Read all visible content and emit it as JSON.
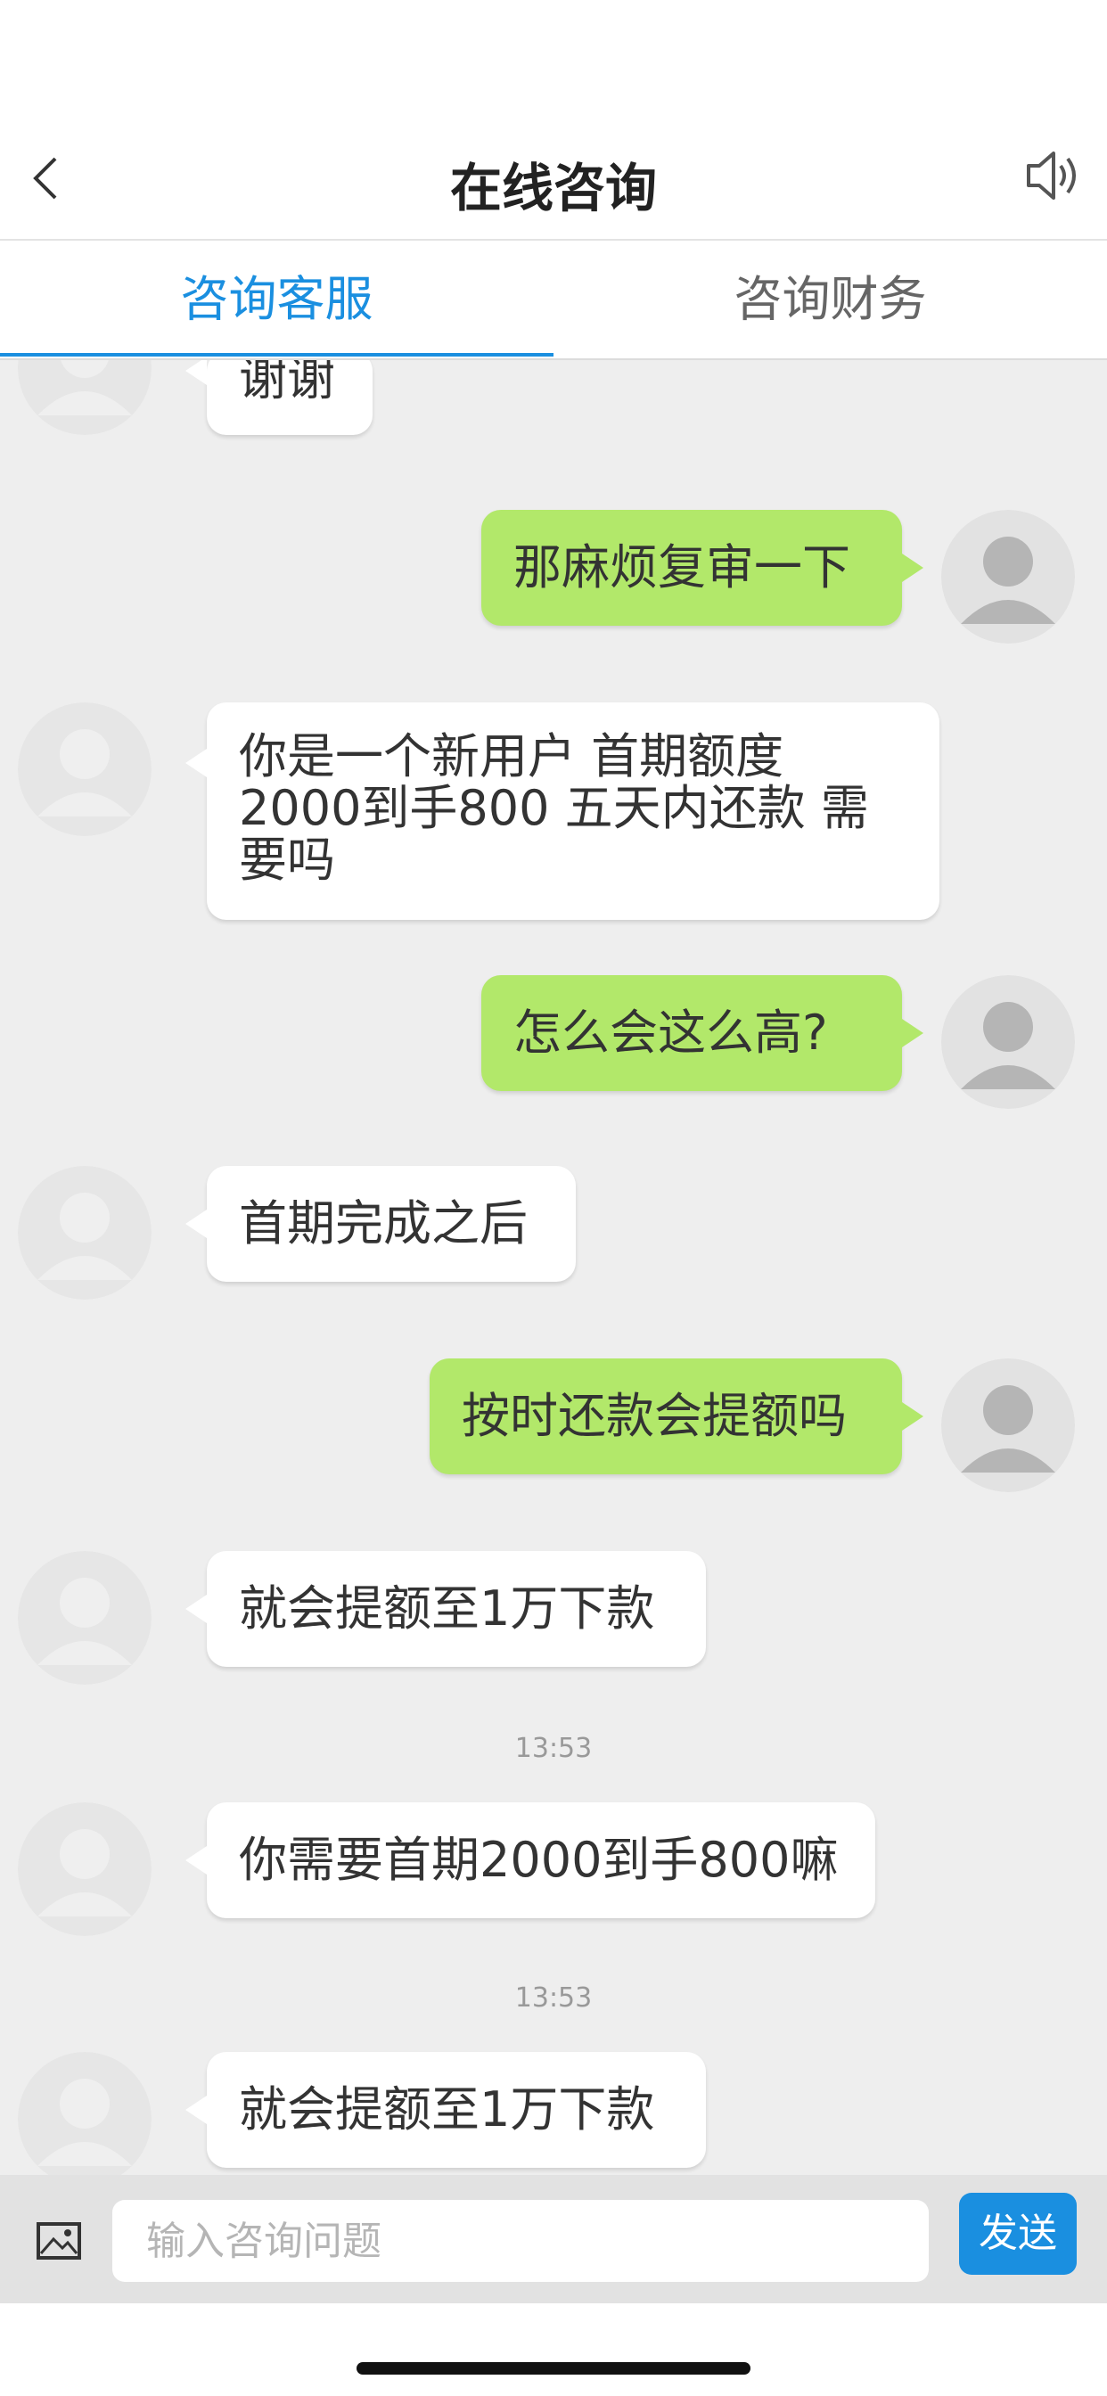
{
  "header": {
    "title": "在线咨询",
    "back_icon": "chevron-left-icon",
    "speaker_icon": "speaker-icon"
  },
  "tabs": [
    {
      "label": "咨询客服",
      "active": true
    },
    {
      "label": "咨询财务",
      "active": false
    }
  ],
  "messages": [
    {
      "side": "left",
      "text": "谢谢"
    },
    {
      "side": "right",
      "text": "那麻烦复审一下"
    },
    {
      "side": "left",
      "lines": [
        "你是一个新用户 首期额度",
        "2000到手800 五天内还款 需",
        "要吗"
      ]
    },
    {
      "side": "right",
      "text": "怎么会这么高?"
    },
    {
      "side": "left",
      "text": "首期完成之后"
    },
    {
      "side": "right",
      "text": "按时还款会提额吗"
    },
    {
      "side": "left",
      "text": "就会提额至1万下款"
    },
    {
      "type": "time",
      "text": "13:53"
    },
    {
      "side": "left",
      "text": "你需要首期2000到手800嘛"
    },
    {
      "type": "time",
      "text": "13:53"
    },
    {
      "side": "left",
      "text": "就会提额至1万下款"
    }
  ],
  "input": {
    "placeholder": "输入咨询问题",
    "image_icon": "image-icon",
    "send_label": "发送"
  },
  "colors": {
    "accent": "#1a8fe0",
    "user_bubble": "#b2e86a",
    "agent_bubble": "#ffffff",
    "chat_background": "#eeeeee"
  }
}
